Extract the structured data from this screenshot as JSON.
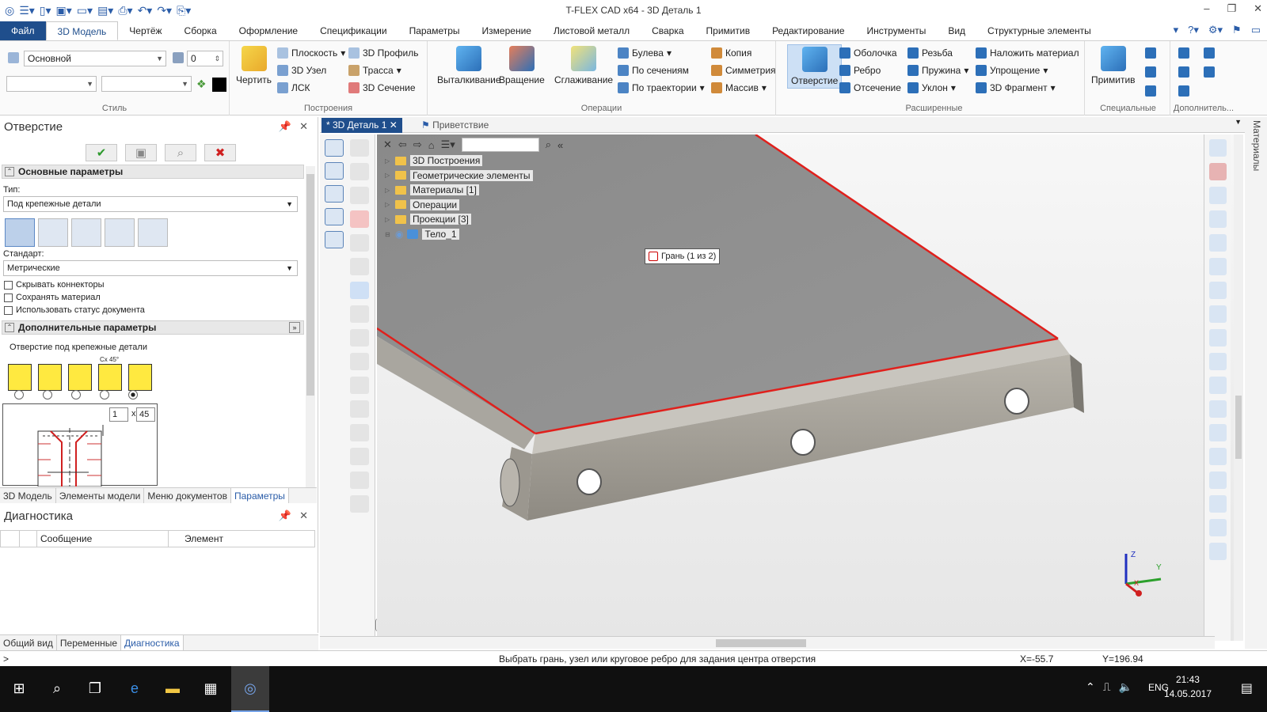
{
  "window": {
    "title": "T-FLEX CAD x64 - 3D Деталь 1"
  },
  "colors": {
    "accent": "#1f4e8c",
    "edge_highlight": "#e0201c",
    "model": "#8c8c8c"
  },
  "menu": {
    "file": "Файл",
    "items": [
      "3D Модель",
      "Чертёж",
      "Сборка",
      "Оформление",
      "Спецификации",
      "Параметры",
      "Измерение",
      "Листовой металл",
      "Сварка",
      "Примитив",
      "Редактирование",
      "Инструменты",
      "Вид",
      "Структурные элементы"
    ],
    "active_index": 0
  },
  "ribbon": {
    "style": {
      "layer_combo": "Основной",
      "layer_num": "0",
      "label": "Стиль"
    },
    "construct": {
      "draw": "Чертить",
      "plane": "Плоскость",
      "profile3d": "3D Профиль",
      "node3d": "3D Узел",
      "path": "Трасса",
      "lsk": "ЛСК",
      "section3d": "3D Сечение",
      "label": "Построения"
    },
    "operations": {
      "extrude": "Выталкивание",
      "rotate": "Вращение",
      "smooth": "Сглаживание",
      "boolean": "Булева",
      "by_sections": "По сечениям",
      "by_path": "По траектории",
      "copy": "Копия",
      "symmetry": "Симметрия",
      "array": "Массив",
      "label": "Операции"
    },
    "extended": {
      "hole": "Отверстие",
      "shell": "Оболочка",
      "rib": "Ребро",
      "cut": "Отсечение",
      "thread": "Резьба",
      "spring": "Пружина",
      "slope": "Уклон",
      "apply_material": "Наложить материал",
      "simplify": "Упрощение",
      "fragment3d": "3D Фрагмент",
      "label": "Расширенные"
    },
    "special": {
      "primitive": "Примитив",
      "label": "Специальные"
    },
    "extra": {
      "label": "Дополнитель..."
    }
  },
  "hole_panel": {
    "title": "Отверстие",
    "section_main": "Основные параметры",
    "type_label": "Тип:",
    "type_value": "Под крепежные детали",
    "standard_label": "Стандарт:",
    "standard_value": "Метрические",
    "chk_hide": "Скрывать коннекторы",
    "chk_save": "Сохранять материал",
    "chk_status": "Использовать статус документа",
    "section_extra": "Дополнительные параметры",
    "extra_desc": "Отверстие под крепежные детали",
    "chamfer_label": "Сх 45°",
    "chamfer_a": "1",
    "chamfer_x": "x",
    "chamfer_b": "45",
    "selected_radio": 4
  },
  "left_tabs": [
    "3D Модель",
    "Элементы модели",
    "Меню документов",
    "Параметры"
  ],
  "left_tabs_active": 3,
  "diagnostics": {
    "title": "Диагностика",
    "col_message": "Сообщение",
    "col_element": "Элемент"
  },
  "bottom_tabs": [
    "Общий вид",
    "Переменные",
    "Диагностика"
  ],
  "bottom_tabs_active": 2,
  "doc_tabs": {
    "active": "* 3D Деталь 1",
    "inactive": "Приветствие"
  },
  "tree": [
    {
      "label": "3D Построения"
    },
    {
      "label": "Геометрические элементы"
    },
    {
      "label": "Материалы [1]"
    },
    {
      "label": "Операции"
    },
    {
      "label": "Проекции [3]"
    },
    {
      "label": "Тело_1"
    }
  ],
  "viewport": {
    "tooltip": "Грань (1 из 2)",
    "axis_z": "Z",
    "axis_y": "Y",
    "axis_x": "X"
  },
  "side_panel": "Материалы",
  "status": {
    "prompt": ">",
    "message": "Выбрать грань, узел или круговое ребро для задания центра отверстия",
    "x": "X=-55.7",
    "y": "Y=196.94"
  },
  "taskbar": {
    "lang": "ENG",
    "time": "21:43",
    "date": "14.05.2017"
  }
}
